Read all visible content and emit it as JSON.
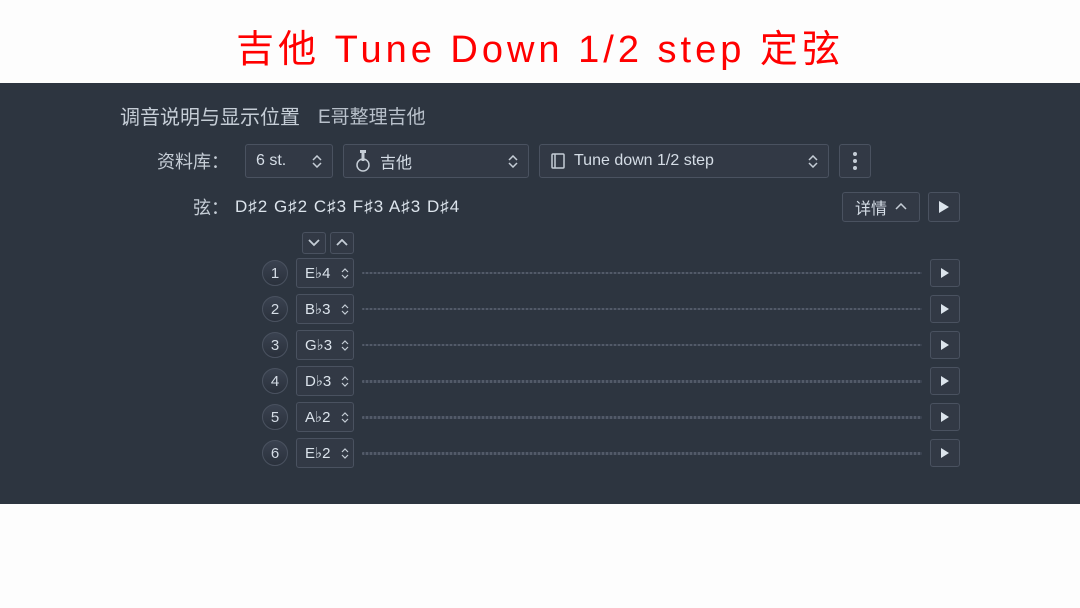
{
  "overlay_title": "吉他 Tune Down 1/2  step 定弦",
  "section": {
    "title": "调音说明与显示位置",
    "subtitle": "E哥整理吉他"
  },
  "library": {
    "label": "资料库：",
    "strings_count": "6 st.",
    "instrument": "吉他",
    "tuning_name": "Tune down 1/2 step"
  },
  "strings_row": {
    "label": "弦：",
    "readout": "D♯2 G♯2 C♯3 F♯3 A♯3 D♯4",
    "details_label": "详情"
  },
  "strings": [
    {
      "num": "1",
      "note": "E♭4"
    },
    {
      "num": "2",
      "note": "B♭3"
    },
    {
      "num": "3",
      "note": "G♭3"
    },
    {
      "num": "4",
      "note": "D♭3"
    },
    {
      "num": "5",
      "note": "A♭2"
    },
    {
      "num": "6",
      "note": "E♭2"
    }
  ]
}
